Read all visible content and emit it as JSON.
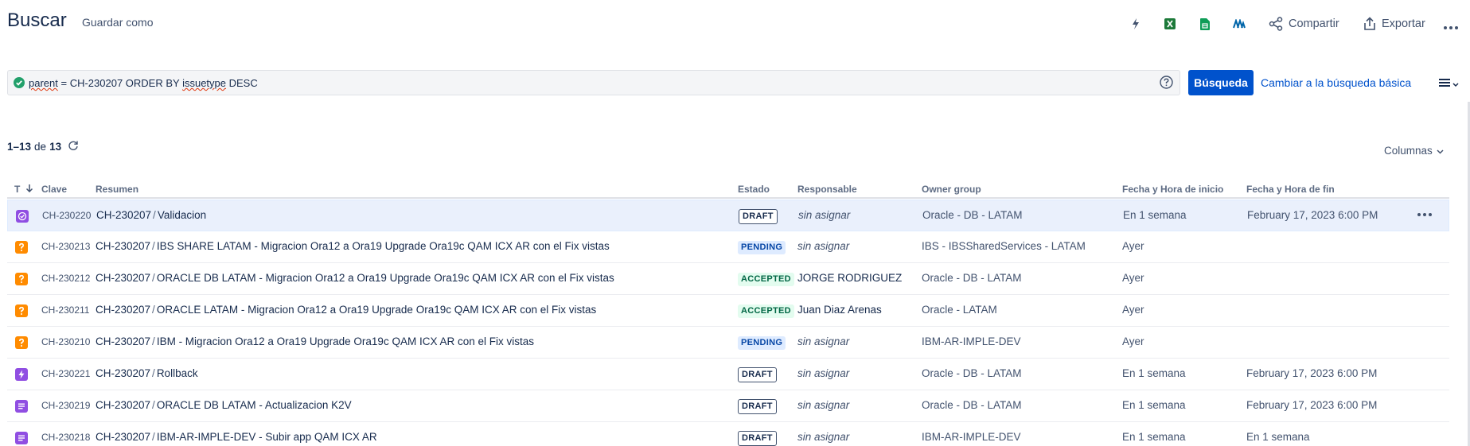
{
  "header": {
    "title": "Buscar",
    "save_as": "Guardar como",
    "share": "Compartir",
    "export": "Exportar"
  },
  "search": {
    "query_parts": [
      "parent",
      " = CH-230207 ORDER BY ",
      "issuetype",
      " DESC"
    ],
    "search_button": "Búsqueda",
    "basic_link": "Cambiar a la búsqueda básica"
  },
  "results": {
    "range": "1–13",
    "of": "de",
    "total": "13",
    "columns_button": "Columnas"
  },
  "table": {
    "headers": {
      "type": "T",
      "key": "Clave",
      "summary": "Resumen",
      "status": "Estado",
      "assignee": "Responsable",
      "owner": "Owner group",
      "start": "Fecha y Hora de inicio",
      "end": "Fecha y Hora de fin"
    },
    "rows": [
      {
        "type_icon": "subtask-check-icon",
        "key": "CH-230220",
        "parent": "CH-230207",
        "summary": "Validacion",
        "status": "DRAFT",
        "assignee": "sin asignar",
        "owner": "Oracle - DB - LATAM",
        "start": "En 1 semana",
        "end": "February 17, 2023 6:00 PM"
      },
      {
        "type_icon": "question-icon",
        "key": "CH-230213",
        "parent": "CH-230207",
        "summary": "IBS SHARE LATAM - Migracion Ora12 a Ora19 Upgrade Ora19c QAM ICX AR con el Fix vistas",
        "status": "PENDING",
        "assignee": "sin asignar",
        "owner": "IBS - IBSSharedServices - LATAM",
        "start": "Ayer",
        "end": ""
      },
      {
        "type_icon": "question-icon",
        "key": "CH-230212",
        "parent": "CH-230207",
        "summary": "ORACLE DB LATAM - Migracion Ora12 a Ora19 Upgrade Ora19c QAM ICX AR con el Fix vistas",
        "status": "ACCEPTED",
        "assignee": "JORGE RODRIGUEZ",
        "owner": "Oracle - DB - LATAM",
        "start": "Ayer",
        "end": ""
      },
      {
        "type_icon": "question-icon",
        "key": "CH-230211",
        "parent": "CH-230207",
        "summary": "ORACLE LATAM - Migracion Ora12 a Ora19 Upgrade Ora19c QAM ICX AR con el Fix vistas",
        "status": "ACCEPTED",
        "assignee": "Juan Diaz Arenas",
        "owner": "Oracle - LATAM",
        "start": "Ayer",
        "end": ""
      },
      {
        "type_icon": "question-icon",
        "key": "CH-230210",
        "parent": "CH-230207",
        "summary": "IBM - Migracion Ora12 a Ora19 Upgrade Ora19c QAM ICX AR con el Fix vistas",
        "status": "PENDING",
        "assignee": "sin asignar",
        "owner": "IBM-AR-IMPLE-DEV",
        "start": "Ayer",
        "end": ""
      },
      {
        "type_icon": "lightning-icon",
        "key": "CH-230221",
        "parent": "CH-230207",
        "summary": "Rollback",
        "status": "DRAFT",
        "assignee": "sin asignar",
        "owner": "Oracle - DB - LATAM",
        "start": "En 1 semana",
        "end": "February 17, 2023 6:00 PM"
      },
      {
        "type_icon": "document-icon",
        "key": "CH-230219",
        "parent": "CH-230207",
        "summary": "ORACLE DB LATAM - Actualizacion K2V",
        "status": "DRAFT",
        "assignee": "sin asignar",
        "owner": "Oracle - DB - LATAM",
        "start": "En 1 semana",
        "end": "February 17, 2023 6:00 PM"
      },
      {
        "type_icon": "document-icon",
        "key": "CH-230218",
        "parent": "CH-230207",
        "summary": "IBM-AR-IMPLE-DEV - Subir app QAM ICX AR",
        "status": "DRAFT",
        "assignee": "sin asignar",
        "owner": "IBM-AR-IMPLE-DEV",
        "start": "En 1 semana",
        "end": "En 1 semana"
      }
    ]
  },
  "colors": {
    "primary": "#0052cc",
    "text": "#172b4d",
    "subtle": "#42526e",
    "subtask_purple": "#904ee2",
    "question_orange": "#ff8b00",
    "excel_green": "#1d7a3a",
    "sheets_green": "#0f9d58",
    "selected_row": "#eaf0fc"
  }
}
